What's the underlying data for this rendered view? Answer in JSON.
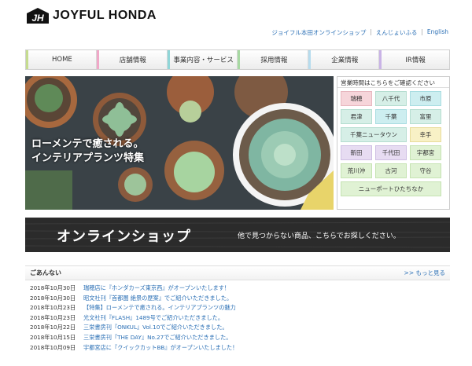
{
  "header": {
    "logo_text": "JOYFUL HONDA",
    "logo_mark_letters": "JH",
    "links": [
      {
        "label": "ジョイフル本田オンラインショップ"
      },
      {
        "label": "えんじょいふる"
      },
      {
        "label": "English"
      }
    ]
  },
  "nav": {
    "items": [
      {
        "label": "HOME",
        "accent": "#c5dc8f"
      },
      {
        "label": "店舗情報",
        "accent": "#f0a8c8"
      },
      {
        "label": "事業内容・サービス",
        "accent": "#90d6d8"
      },
      {
        "label": "採用情報",
        "accent": "#a7d9a2"
      },
      {
        "label": "企業情報",
        "accent": "#b6dcee"
      },
      {
        "label": "IR情報",
        "accent": "#c9b3e6"
      }
    ]
  },
  "hero": {
    "caption_line1": "ローメンテで癒される。",
    "caption_line2": "インテリアプランツ特集"
  },
  "stores": {
    "heading": "営業時間はこちらをご確認ください",
    "items": [
      {
        "label": "瑞穂",
        "color": "pink",
        "span": 1
      },
      {
        "label": "八千代",
        "color": "mint",
        "span": 1
      },
      {
        "label": "市原",
        "color": "teal",
        "span": 1
      },
      {
        "label": "君津",
        "color": "mint",
        "span": 1
      },
      {
        "label": "千葉",
        "color": "teal",
        "span": 1
      },
      {
        "label": "富里",
        "color": "mint",
        "span": 1
      },
      {
        "label": "千葉ニュータウン",
        "color": "mint",
        "span": 2
      },
      {
        "label": "幸手",
        "color": "yellow",
        "span": 1
      },
      {
        "label": "新田",
        "color": "lav",
        "span": 1
      },
      {
        "label": "千代田",
        "color": "lav",
        "span": 1
      },
      {
        "label": "宇都宮",
        "color": "green",
        "span": 1
      },
      {
        "label": "荒川沖",
        "color": "green",
        "span": 1
      },
      {
        "label": "古河",
        "color": "green",
        "span": 1
      },
      {
        "label": "守谷",
        "color": "green",
        "span": 1
      },
      {
        "label": "ニューポートひたちなか",
        "color": "green",
        "span": 3
      }
    ]
  },
  "banner": {
    "title": "オンラインショップ",
    "subtitle": "他で見つからない商品、こちらでお探しください。"
  },
  "news": {
    "title": "ごあんない",
    "more_label": ">> もっと見る",
    "items": [
      {
        "date": "2018年10月30日",
        "text": "瑞穂店に『ホンダカーズ東京西』がオープンいたします！"
      },
      {
        "date": "2018年10月30日",
        "text": "昭文社刊『首都圏 絶景の歴案』でご紹介いただきました。"
      },
      {
        "date": "2018年10月23日",
        "text": "【特集】ローメンテで癒される。インテリアプランツの魅力"
      },
      {
        "date": "2018年10月23日",
        "text": "光文社刊『FLASH』1489号でご紹介いただきました。"
      },
      {
        "date": "2018年10月22日",
        "text": "三栄書房刊『ONKUL』Vol.10でご紹介いただきました。"
      },
      {
        "date": "2018年10月15日",
        "text": "三栄書房刊『THE DAY』No.27でご紹介いただきました。"
      },
      {
        "date": "2018年10月09日",
        "text": "宇都宮店に『クイックカットBB』がオープンいたしました！"
      }
    ]
  }
}
